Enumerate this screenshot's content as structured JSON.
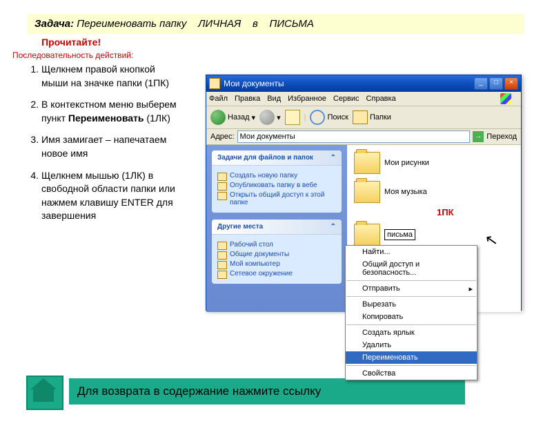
{
  "task": {
    "label": "Задача:",
    "text": "Переименовать папку",
    "from": "ЛИЧНАЯ",
    "mid": "в",
    "to": "ПИСЬМА"
  },
  "read_hint": "Прочитайте!",
  "seq_label": "Последовательность действий:",
  "steps": [
    "Щелкнем правой кнопкой мыши на значке папки (1ПК)",
    {
      "pre": "В контекстном меню выберем пункт ",
      "bold": "Переименовать",
      "post": " (1ЛК)"
    },
    "Имя замигает – напечатаем новое имя",
    "Щелкнем мышью (1ЛК) в свободной области папки или нажмем клавишу ENTER для завершения"
  ],
  "explorer": {
    "title": "Мои документы",
    "menu": [
      "Файл",
      "Правка",
      "Вид",
      "Избранное",
      "Сервис",
      "Справка"
    ],
    "toolbar": {
      "back": "Назад",
      "search": "Поиск",
      "folders": "Папки"
    },
    "address": {
      "label": "Адрес:",
      "value": "Мои документы",
      "go": "Переход"
    },
    "tasks": {
      "header": "Задачи для файлов и папок",
      "items": [
        "Создать новую папку",
        "Опубликовать папку в вебе",
        "Открыть общий доступ к этой папке"
      ]
    },
    "places": {
      "header": "Другие места",
      "items": [
        "Рабочий стол",
        "Общие документы",
        "Мой компьютер",
        "Сетевое окружение"
      ]
    },
    "files": [
      "Мои рисунки",
      "Моя музыка"
    ],
    "rename_value": "письма",
    "red_label": "1ПК"
  },
  "context_menu": [
    "Найти...",
    "Общий доступ и безопасность...",
    "Отправить",
    "Вырезать",
    "Копировать",
    "Создать ярлык",
    "Удалить",
    "Переименовать",
    "Свойства"
  ],
  "footer": "Для возврата в содержание нажмите ссылку"
}
